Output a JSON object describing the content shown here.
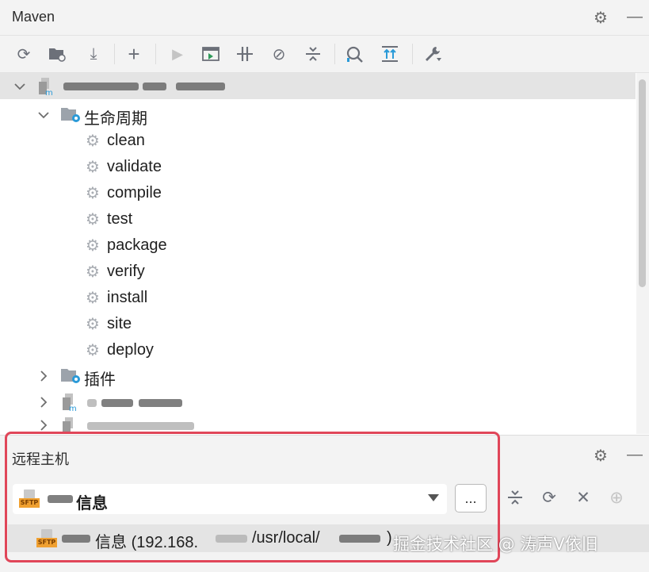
{
  "maven_panel": {
    "title": "Maven",
    "header_icons": [
      "gear-icon",
      "minimize-icon"
    ]
  },
  "toolbar": {
    "buttons": [
      {
        "name": "reload-icon",
        "glyph": "⟳"
      },
      {
        "name": "generate-sources-icon",
        "glyph": "▬"
      },
      {
        "name": "download-icon",
        "glyph": "⤓"
      },
      {
        "name": "add-icon",
        "glyph": "+"
      },
      {
        "name": "run-icon",
        "glyph": "▶"
      },
      {
        "name": "execute-goal-icon",
        "glyph": "▣"
      },
      {
        "name": "toggle-offline-icon",
        "glyph": "⫽"
      },
      {
        "name": "skip-tests-icon",
        "glyph": "⊘"
      },
      {
        "name": "collapse-all-icon",
        "glyph": "≑"
      },
      {
        "name": "analyze-dependencies-icon",
        "glyph": "◠"
      },
      {
        "name": "show-dependencies-icon",
        "glyph": "⇈"
      },
      {
        "name": "settings-wrench-icon",
        "glyph": "🔧"
      }
    ]
  },
  "tree": {
    "lifecycle_label": "生命周期",
    "lifecycle_goals": [
      "clean",
      "validate",
      "compile",
      "test",
      "package",
      "verify",
      "install",
      "site",
      "deploy"
    ],
    "plugins_label": "插件"
  },
  "remote_hosts": {
    "title": "远程主机",
    "selected_host_suffix": "信息",
    "more_button_label": "...",
    "host_row": {
      "name_suffix": "信息",
      "address_prefix": "(192.168.",
      "path_text": "/usr/local/",
      "close_paren": ")"
    },
    "sftp_badge": "SFTP"
  },
  "watermark": "掘金技术社区 @ 涛声V依旧",
  "colors": {
    "panel_bg": "#f3f3f3",
    "selection_bg": "#e4e4e4",
    "highlight_border": "#e04659",
    "folder_blue": "#2a9ad8"
  }
}
